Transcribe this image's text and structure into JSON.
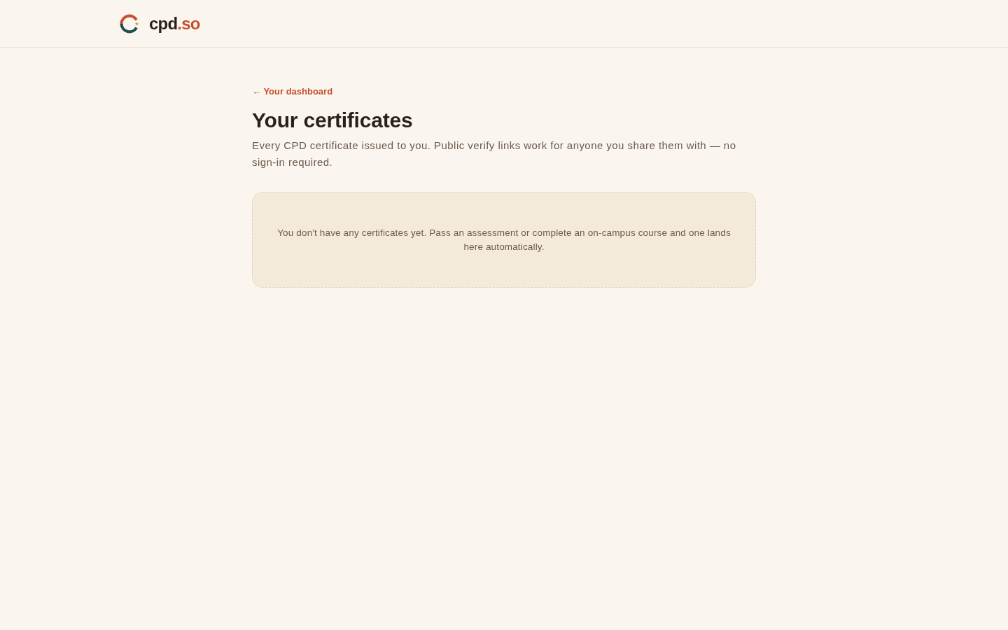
{
  "header": {
    "logo": {
      "name": "cpd",
      "suffix": ".so"
    }
  },
  "back_link": {
    "label": "← Your dashboard"
  },
  "page": {
    "title": "Your certificates",
    "description": "Every CPD certificate issued to you. Public verify links work for anyone you share them with — no sign-in required."
  },
  "empty_state": {
    "message": "You don't have any certificates yet. Pass an assessment or complete an on-campus course and one lands here automatically."
  }
}
